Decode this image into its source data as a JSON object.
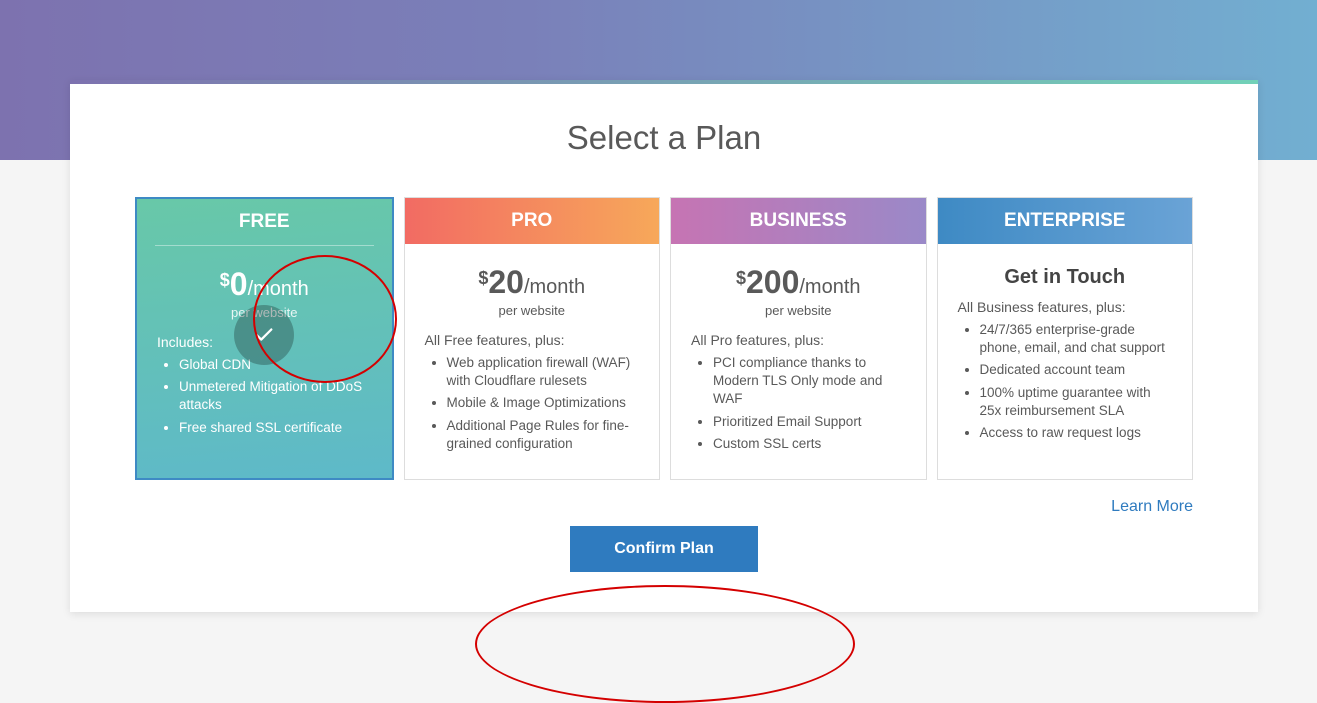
{
  "title": "Select a Plan",
  "plans": [
    {
      "name": "FREE",
      "price_currency": "$",
      "price_amount": "0",
      "price_period": "/month",
      "sub": "per website",
      "lead": "Includes:",
      "features": [
        "Global CDN",
        "Unmetered Mitigation of DDoS attacks",
        "Free shared SSL certificate"
      ],
      "selected": true
    },
    {
      "name": "PRO",
      "price_currency": "$",
      "price_amount": "20",
      "price_period": "/month",
      "sub": "per website",
      "lead": "All Free features, plus:",
      "features": [
        "Web application firewall (WAF) with Cloudflare rulesets",
        "Mobile & Image Optimizations",
        "Additional Page Rules for fine-grained configuration"
      ]
    },
    {
      "name": "BUSINESS",
      "price_currency": "$",
      "price_amount": "200",
      "price_period": "/month",
      "sub": "per website",
      "lead": "All Pro features, plus:",
      "features": [
        "PCI compliance thanks to Modern TLS Only mode and WAF",
        "Prioritized Email Support",
        "Custom SSL certs"
      ]
    },
    {
      "name": "ENTERPRISE",
      "get_in_touch": "Get in Touch",
      "lead": "All Business features, plus:",
      "features": [
        "24/7/365 enterprise-grade phone, email, and chat support",
        "Dedicated account team",
        "100% uptime guarantee with 25x reimbursement SLA",
        "Access to raw request logs"
      ]
    }
  ],
  "learn_more": "Learn More",
  "confirm_button": "Confirm Plan"
}
